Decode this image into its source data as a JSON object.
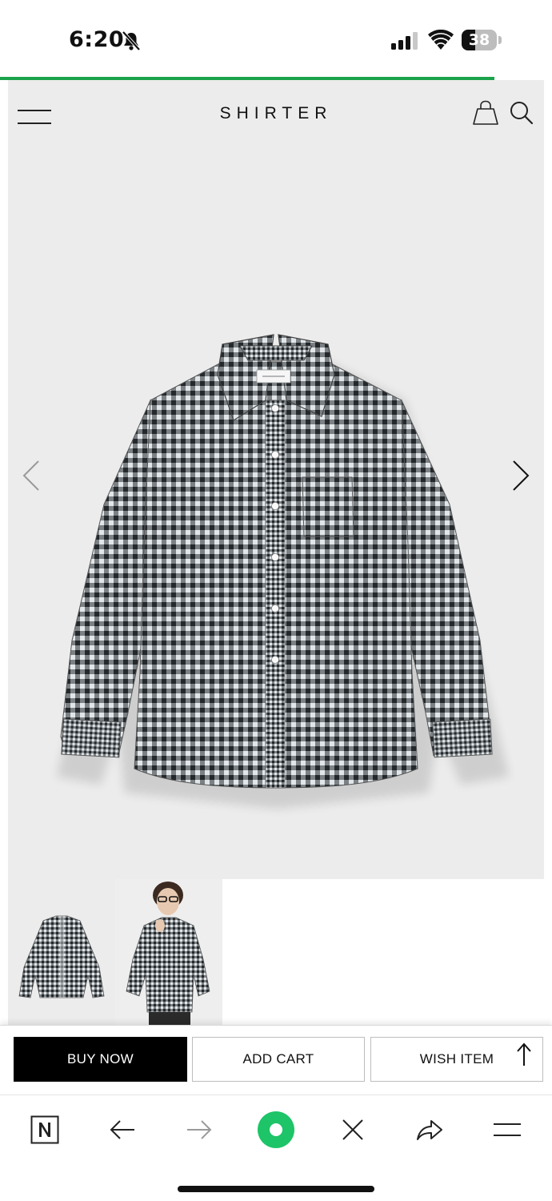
{
  "status_bar": {
    "time": "6:20",
    "battery_level": "38",
    "icons": [
      "bell-slash-icon",
      "cellular-signal-icon",
      "wifi-icon",
      "battery-icon"
    ]
  },
  "page_load_progress": 0.9,
  "header": {
    "brand": "SHIRTER",
    "icons": [
      "menu-icon",
      "shopping-bag-icon",
      "search-icon"
    ]
  },
  "gallery": {
    "main_image": "gingham-check-shirt",
    "thumbnails": [
      "shirt-flat-lay",
      "model-wearing-shirt"
    ],
    "colors": {
      "background": "#ececec",
      "check_dark": "#2d3133",
      "check_light": "#d5d9dc"
    }
  },
  "actions": {
    "buy_now": "BUY NOW",
    "add_cart": "ADD CART",
    "wish_item": "WISH ITEM"
  },
  "browser_toolbar": {
    "icons": [
      "naver-n-icon",
      "back-arrow-icon",
      "forward-arrow-icon",
      "green-home-icon",
      "close-icon",
      "share-icon",
      "menu-lines-icon"
    ],
    "accent": "#1ec468"
  }
}
